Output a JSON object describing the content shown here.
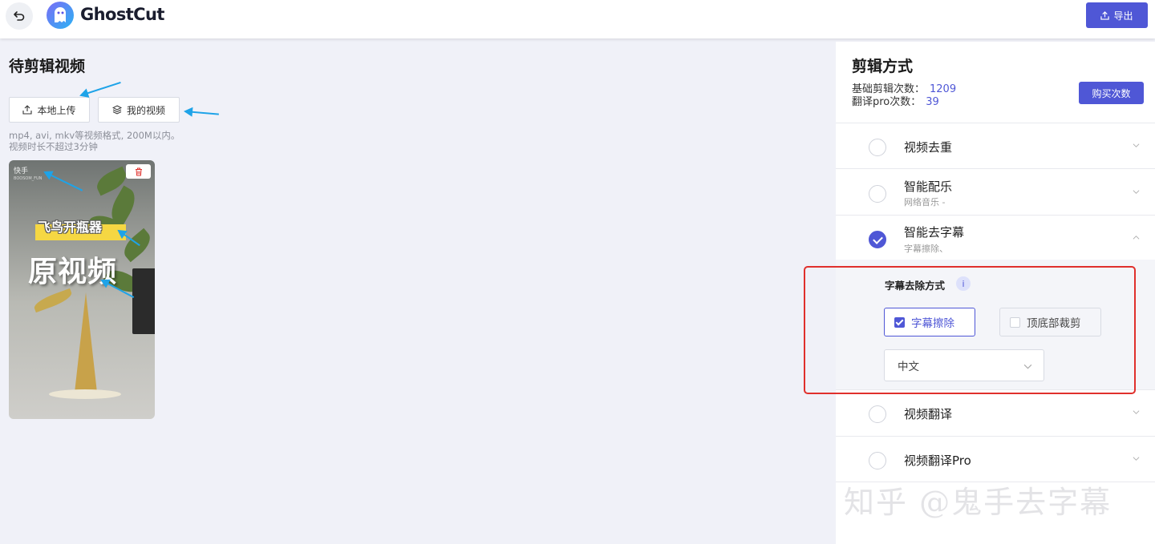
{
  "header": {
    "brand": "GhostCut",
    "export_label": "导出"
  },
  "left": {
    "title": "待剪辑视频",
    "local_upload": "本地上传",
    "my_videos": "我的视频",
    "hint_line1": "mp4, avi, mkv等视频格式, 200M以内。",
    "hint_line2": "视频时长不超过3分钟",
    "video": {
      "watermark": "快手",
      "watermark_sub": "BOOSOM_FUN",
      "banner_text": "飞鸟开瓶器",
      "overlay_text": "原视频"
    }
  },
  "right": {
    "title": "剪辑方式",
    "stats": [
      {
        "label": "基础剪辑次数：",
        "value": "1209"
      },
      {
        "label": "翻译pro次数：",
        "value": "39"
      }
    ],
    "buy_label": "购买次数",
    "options": [
      {
        "label": "视频去重",
        "sub": "",
        "checked": false
      },
      {
        "label": "智能配乐",
        "sub": "网络音乐 -",
        "checked": false
      },
      {
        "label": "智能去字幕",
        "sub": "字幕擦除、",
        "checked": true
      },
      {
        "label": "视频翻译",
        "sub": "",
        "checked": false
      },
      {
        "label": "视频翻译Pro",
        "sub": "",
        "checked": false
      }
    ],
    "subtitle_removal": {
      "title": "字幕去除方式",
      "info": "i",
      "erase_label": "字幕擦除",
      "erase_checked": true,
      "crop_label": "顶底部裁剪",
      "crop_checked": false,
      "language": "中文"
    }
  },
  "watermark": "知乎 @鬼手去字幕",
  "colors": {
    "accent": "#4f57d6",
    "annotation_arrow": "#1ea3e8",
    "annotation_box": "#e0302c"
  }
}
